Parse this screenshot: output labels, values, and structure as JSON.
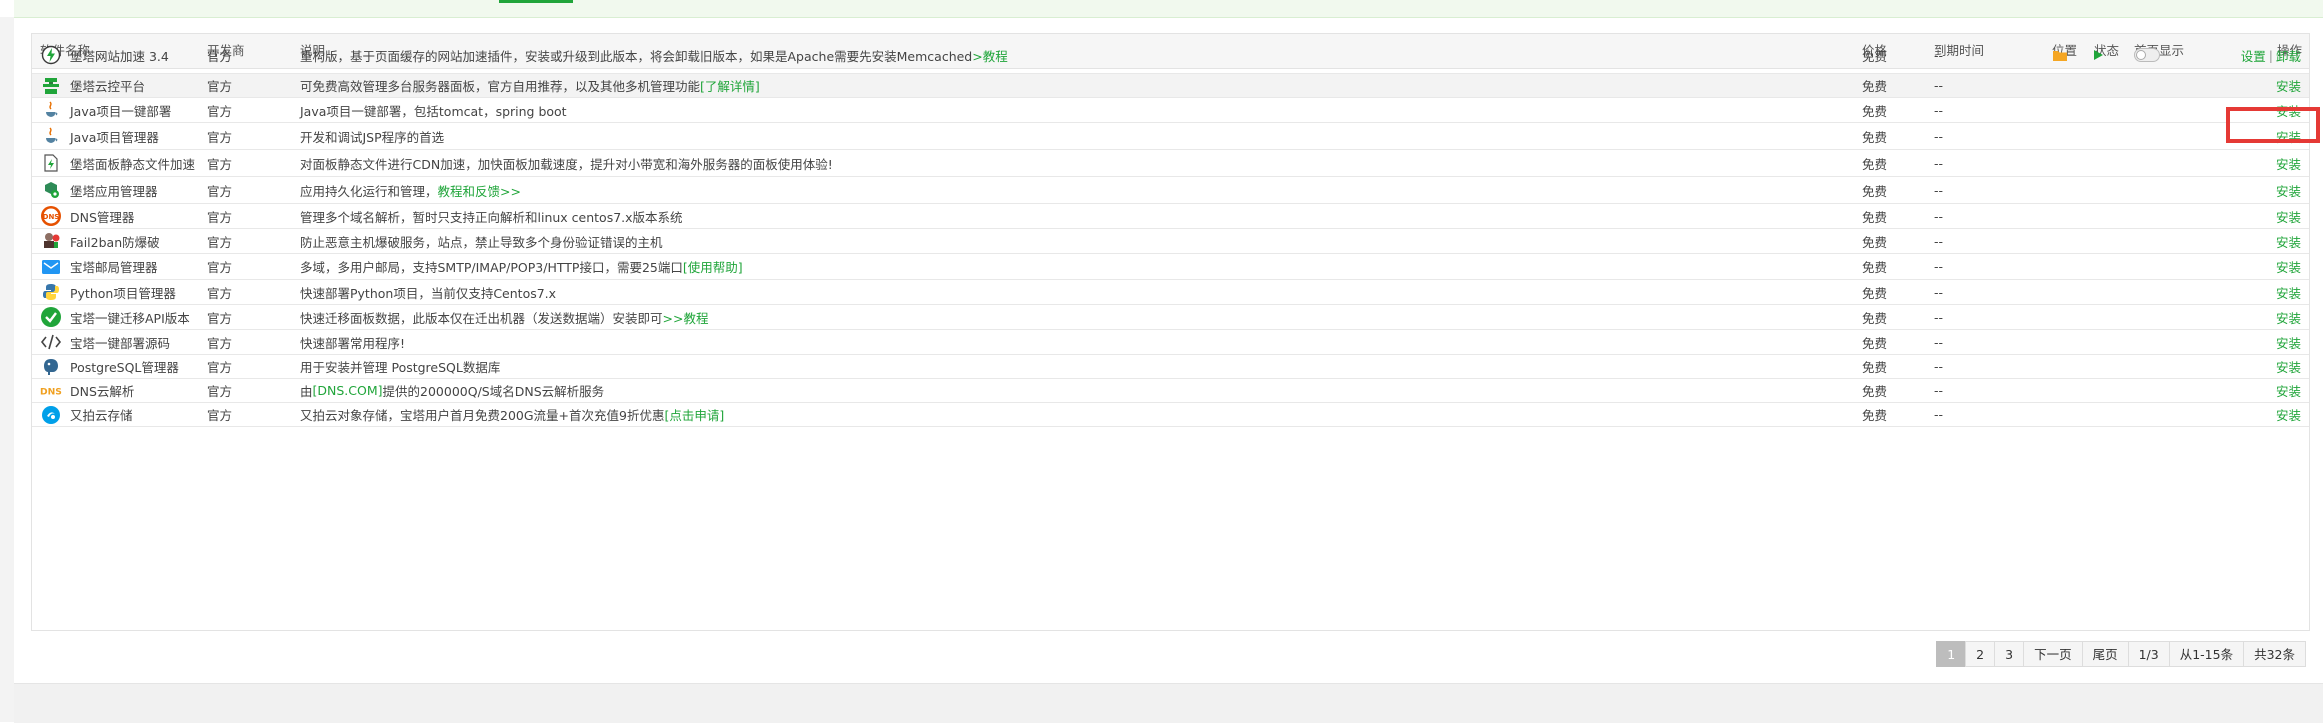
{
  "table": {
    "headers": {
      "name": "软件名称",
      "vendor": "开发商",
      "desc": "说明",
      "price": "价格",
      "expire": "到期时间",
      "location": "位置",
      "status": "状态",
      "homepage": "首页显示",
      "action": "操作"
    },
    "rows": [
      {
        "name": "堡塔网站加速 3.4",
        "vendor": "官方",
        "desc": "重构版，基于页面缓存的网站加速插件，安装或升级到此版本，将会卸载旧版本，如果是Apache需要先安装Memcached",
        "link": ">教程",
        "price": "免费",
        "expire": "--",
        "action1": "设置",
        "action2": "卸载",
        "icon": "bolt-icon"
      },
      {
        "name": "堡塔云控平台",
        "vendor": "官方",
        "desc": "可免费高效管理多台服务器面板，官方自用推荐，以及其他多机管理功能",
        "link": "[了解详情]",
        "price": "免费",
        "expire": "--",
        "action1": "安装",
        "icon": "cloud-control-icon"
      },
      {
        "name": "Java项目一键部署",
        "vendor": "官方",
        "desc": "Java项目一键部署，包括tomcat，spring boot",
        "link": "",
        "price": "免费",
        "expire": "--",
        "action1": "安装",
        "icon": "java-icon"
      },
      {
        "name": "Java项目管理器",
        "vendor": "官方",
        "desc": "开发和调试JSP程序的首选",
        "link": "",
        "price": "免费",
        "expire": "--",
        "action1": "安装",
        "icon": "java-icon"
      },
      {
        "name": "堡塔面板静态文件加速",
        "vendor": "官方",
        "desc": "对面板静态文件进行CDN加速，加快面板加载速度，提升对小带宽和海外服务器的面板使用体验!",
        "link": "",
        "price": "免费",
        "expire": "--",
        "action1": "安装",
        "icon": "static-file-icon"
      },
      {
        "name": "堡塔应用管理器",
        "vendor": "官方",
        "desc": "应用持久化运行和管理，",
        "link": "教程和反馈>>",
        "price": "免费",
        "expire": "--",
        "action1": "安装",
        "icon": "app-manager-icon"
      },
      {
        "name": "DNS管理器",
        "vendor": "官方",
        "desc": "管理多个域名解析，暂时只支持正向解析和linux centos7.x版本系统",
        "link": "",
        "price": "免费",
        "expire": "--",
        "action1": "安装",
        "icon": "dns-badge-icon"
      },
      {
        "name": "Fail2ban防爆破",
        "vendor": "官方",
        "desc": "防止恶意主机爆破服务，站点，禁止导致多个身份验证错误的主机",
        "link": "",
        "price": "免费",
        "expire": "--",
        "action1": "安装",
        "icon": "fail2ban-icon"
      },
      {
        "name": "宝塔邮局管理器",
        "vendor": "官方",
        "desc": "多域，多用户邮局，支持SMTP/IMAP/POP3/HTTP接口，需要25端口",
        "link": "[使用帮助]",
        "price": "免费",
        "expire": "--",
        "action1": "安装",
        "icon": "mail-icon"
      },
      {
        "name": "Python项目管理器",
        "vendor": "官方",
        "desc": "快速部署Python项目，当前仅支持Centos7.x",
        "link": "",
        "price": "免费",
        "expire": "--",
        "action1": "安装",
        "icon": "python-icon"
      },
      {
        "name": "宝塔一键迁移API版本",
        "vendor": "官方",
        "desc": "快速迁移面板数据，此版本仅在迁出机器（发送数据端）安装即可",
        "link": ">>教程",
        "price": "免费",
        "expire": "--",
        "action1": "安装",
        "icon": "check-circle-icon"
      },
      {
        "name": "宝塔一键部署源码",
        "vendor": "官方",
        "desc": "快速部署常用程序!",
        "link": "",
        "price": "免费",
        "expire": "--",
        "action1": "安装",
        "icon": "code-icon"
      },
      {
        "name": "PostgreSQL管理器",
        "vendor": "官方",
        "desc": "用于安装并管理 PostgreSQL数据库",
        "link": "",
        "price": "免费",
        "expire": "--",
        "action1": "安装",
        "icon": "postgresql-icon"
      },
      {
        "name": "DNS云解析",
        "vendor": "官方",
        "desc": "由",
        "link": "[DNS.COM]",
        "desc_after": "提供的200000Q/S域名DNS云解析服务",
        "price": "免费",
        "expire": "--",
        "action1": "安装",
        "icon": "dns-text-icon"
      },
      {
        "name": "又拍云存储",
        "vendor": "官方",
        "desc": "又拍云对象存储，宝塔用户首月免费200G流量+首次充值9折优惠",
        "link": "[点击申请]",
        "price": "免费",
        "expire": "--",
        "action1": "安装",
        "icon": "upyun-icon"
      }
    ]
  },
  "pagination": {
    "pages": [
      "1",
      "2",
      "3"
    ],
    "current": "1",
    "next": "下一页",
    "last": "尾页",
    "page_info": "1/3",
    "range": "从1-15条",
    "total": "共32条"
  },
  "colors": {
    "accent": "#20a53a",
    "highlight": "#e53935"
  }
}
